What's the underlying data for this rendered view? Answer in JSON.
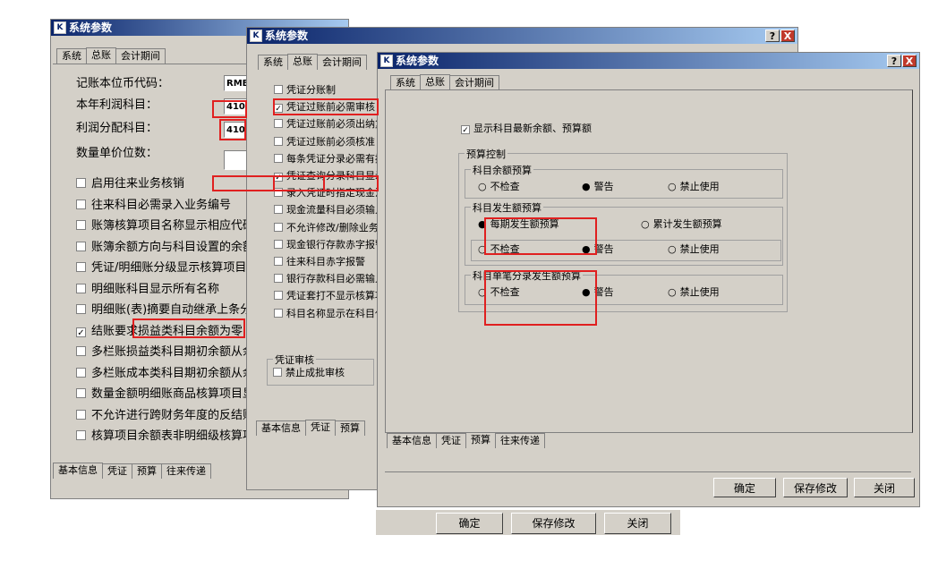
{
  "window_title": "系统参数",
  "logo_glyph": "K",
  "top_tabs": [
    "系统",
    "总账",
    "会计期间"
  ],
  "bottom_tabs": [
    "基本信息",
    "凭证",
    "预算",
    "往来传递"
  ],
  "win1": {
    "currency_label": "记账本位币代码：",
    "currency_value": "RMB",
    "profit_label": "本年利润科目：",
    "profit_value": "410",
    "distribution_label": "利润分配科目：",
    "distribution_value": "410",
    "qty_label": "数量单价位数：",
    "options": [
      {
        "label": "启用往来业务核销",
        "checked": false
      },
      {
        "label": "往来科目必需录入业务编号",
        "checked": false
      },
      {
        "label": "账簿核算项目名称显示相应代码",
        "checked": false
      },
      {
        "label": "账簿余额方向与科目设置的余额方向相同",
        "checked": false
      },
      {
        "label": "凭证/明细账分级显示核算项目名称",
        "checked": false
      },
      {
        "label": "明细账科目显示所有名称",
        "checked": false
      },
      {
        "label": "明细账(表)摘要自动继承上条分录摘要",
        "checked": false
      },
      {
        "label": "结账要求损益类科目余额为零",
        "checked": true
      },
      {
        "label": "多栏账损益类科目期初余额从余额表取数",
        "checked": false
      },
      {
        "label": "多栏账成本类科目期初余额从余额表取数",
        "checked": false
      },
      {
        "label": "数量金额明细账商品核算项目显示规格型号",
        "checked": false
      },
      {
        "label": "不允许进行跨财务年度的反结账",
        "checked": false
      },
      {
        "label": "核算项目余额表非明细级核算项目余额合并在一个方向",
        "checked": false
      }
    ],
    "ok": "确定",
    "save": "保存修改",
    "close": "关闭"
  },
  "win2": {
    "options": [
      {
        "label": "凭证分账制",
        "checked": false
      },
      {
        "label": "凭证过账前必需审核",
        "checked": true
      },
      {
        "label": "凭证过账前必须出纳复核",
        "checked": false
      },
      {
        "label": "凭证过账前必须核准",
        "checked": false
      },
      {
        "label": "每条凭证分录必需有摘要",
        "checked": false
      },
      {
        "label": "凭证查询分录科目显示代码",
        "checked": true
      },
      {
        "label": "录入凭证时指定现金流量附表项目",
        "checked": false
      },
      {
        "label": "现金流量科目必须输入现金流量项目",
        "checked": false
      },
      {
        "label": "不允许修改/删除业务系统凭证",
        "checked": false
      },
      {
        "label": "现金银行存款赤字报警",
        "checked": false
      },
      {
        "label": "往来科目赤字报警",
        "checked": false
      },
      {
        "label": "银行存款科目必需输入结算方式和结算号",
        "checked": false
      },
      {
        "label": "凭证套打不显示核算项目名称",
        "checked": false
      },
      {
        "label": "科目名称显示在科目代码之后",
        "checked": false
      }
    ],
    "review_group": "凭证审核",
    "review_option": "禁止成批审核"
  },
  "win3": {
    "show_latest": "显示科目最新余额、预算额",
    "budget_control": "预算控制",
    "group1": "科目余额预算",
    "group2": "科目发生额预算",
    "group3": "科目单笔分录发生额预算",
    "opt_none": "不检查",
    "opt_warn": "警告",
    "opt_forbid": "禁止使用",
    "opt_period": "每期发生额预算",
    "opt_cumulative": "累计发生额预算",
    "ok": "确定",
    "save": "保存修改",
    "close": "关闭",
    "help": "?",
    "close_x": "X"
  }
}
